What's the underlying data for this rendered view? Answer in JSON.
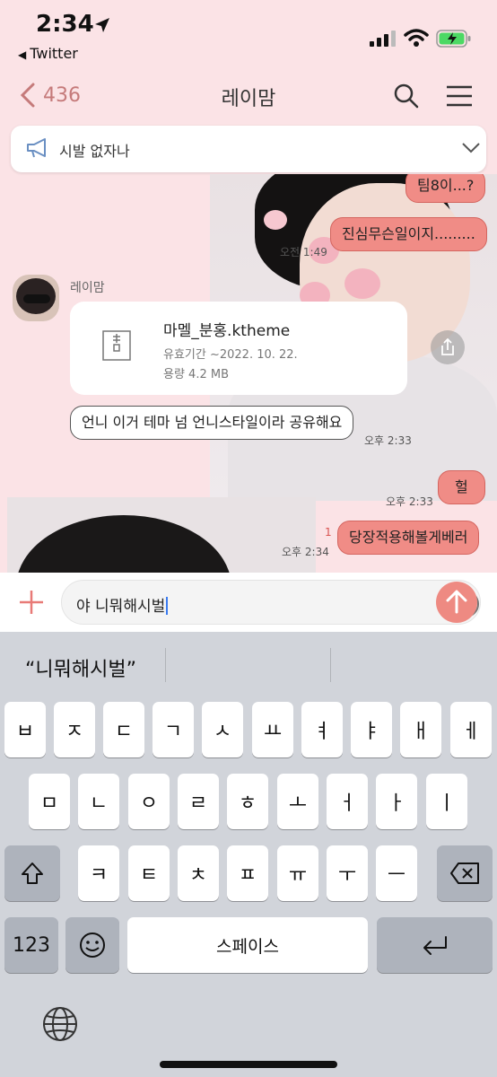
{
  "status_bar": {
    "time": "2:34",
    "back_app": "Twitter"
  },
  "header": {
    "back_count": "436",
    "room_title": "레이맘"
  },
  "notice": {
    "text": "시발 없자나"
  },
  "messages": {
    "m1": "팀8이...?",
    "m2": "진심무슨일이지.........",
    "m2_time": "오전 1:49",
    "sender": "레이맘",
    "file": {
      "name": "마멜_분홍.ktheme",
      "validity": "유효기간  ~2022. 10. 22.",
      "size": "용량  4.2 MB"
    },
    "m3": "언니 이거 테마 넘 언니스타일이라 공유해요",
    "m3_time": "오후 2:33",
    "m4": "헐",
    "m4_time": "오후 2:33",
    "m5": "당장적용해볼게베러",
    "m5_time": "오후 2:34",
    "m5_unread": "1"
  },
  "input": {
    "text": "야 니뭐해시벌"
  },
  "keyboard": {
    "suggestion": "“니뭐해시벌”",
    "row1": [
      "ㅂ",
      "ㅈ",
      "ㄷ",
      "ㄱ",
      "ㅅ",
      "ㅛ",
      "ㅕ",
      "ㅑ",
      "ㅐ",
      "ㅔ"
    ],
    "row2": [
      "ㅁ",
      "ㄴ",
      "ㅇ",
      "ㄹ",
      "ㅎ",
      "ㅗ",
      "ㅓ",
      "ㅏ",
      "ㅣ"
    ],
    "row3": [
      "ㅋ",
      "ㅌ",
      "ㅊ",
      "ㅍ",
      "ㅠ",
      "ㅜ",
      "ㅡ"
    ],
    "numbers_label": "123",
    "space_label": "스페이스"
  },
  "colors": {
    "my_bubble": "#f08c86",
    "background": "#fbe3e6",
    "accent": "#c57a7a"
  }
}
